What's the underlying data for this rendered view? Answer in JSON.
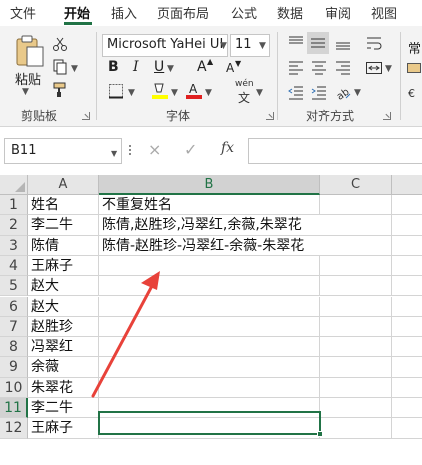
{
  "menu": {
    "tabs": [
      "文件",
      "开始",
      "插入",
      "页面布局",
      "公式",
      "数据",
      "审阅",
      "视图"
    ],
    "active_tab": "开始"
  },
  "ribbon": {
    "clipboard": {
      "paste_label": "粘贴",
      "group_label": "剪贴板"
    },
    "font": {
      "font_name": "Microsoft YaHei UI",
      "font_size": "11",
      "bold": "B",
      "italic": "I",
      "underline": "U",
      "grow": "A",
      "shrink": "A",
      "phonetic": "wén",
      "group_label": "字体"
    },
    "alignment": {
      "group_label": "对齐方式"
    },
    "overflow_label": "常"
  },
  "formula_bar": {
    "name_box": "B11",
    "cancel_icon": "×",
    "confirm_icon": "✓",
    "fx_label": "fx",
    "formula": ""
  },
  "sheet": {
    "columns": [
      "A",
      "B",
      "C"
    ],
    "selected_column": "B",
    "rows": [
      {
        "n": "1",
        "a": "姓名",
        "b": "不重复姓名"
      },
      {
        "n": "2",
        "a": "李二牛",
        "b": "陈倩,赵胜珍,冯翠红,余薇,朱翠花"
      },
      {
        "n": "3",
        "a": "陈倩",
        "b": "陈倩-赵胜珍-冯翠红-余薇-朱翠花"
      },
      {
        "n": "4",
        "a": "王麻子",
        "b": ""
      },
      {
        "n": "5",
        "a": "赵大",
        "b": ""
      },
      {
        "n": "6",
        "a": "赵大",
        "b": ""
      },
      {
        "n": "7",
        "a": "赵胜珍",
        "b": ""
      },
      {
        "n": "8",
        "a": "冯翠红",
        "b": ""
      },
      {
        "n": "9",
        "a": "余薇",
        "b": ""
      },
      {
        "n": "10",
        "a": "朱翠花",
        "b": ""
      },
      {
        "n": "11",
        "a": "李二牛",
        "b": ""
      },
      {
        "n": "12",
        "a": "王麻子",
        "b": ""
      }
    ],
    "selected_row": "11",
    "selected_cell": "B11"
  },
  "colors": {
    "accent": "#217346",
    "annotation_arrow": "#e8423a"
  }
}
